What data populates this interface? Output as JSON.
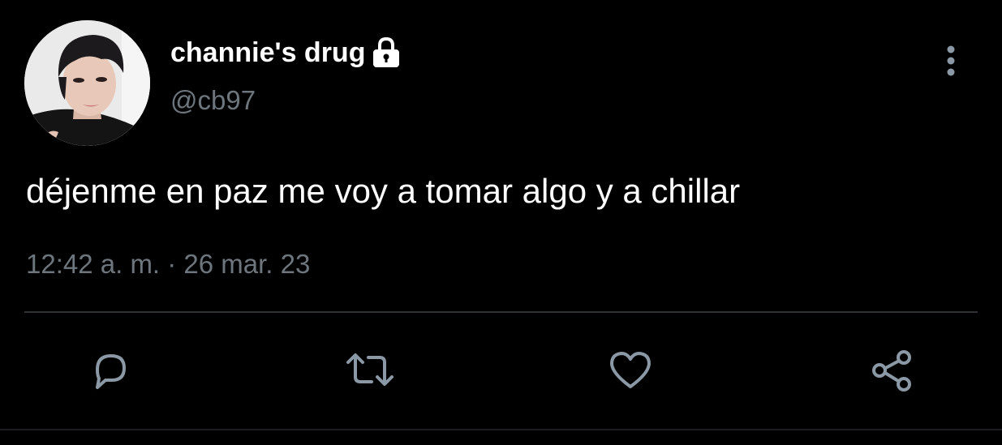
{
  "tweet": {
    "display_name": "channie's drug",
    "handle": "@cb97",
    "protected": true,
    "text": "déjenme en paz me voy a tomar algo y a chillar",
    "timestamp": "12:42 a. m. · 26 mar. 23"
  },
  "icons": {
    "protected": "lock-icon",
    "more": "more-vertical-icon",
    "reply": "reply-icon",
    "retweet": "retweet-icon",
    "like": "heart-icon",
    "share": "share-icon"
  },
  "colors": {
    "background": "#000000",
    "primary_text": "#ffffff",
    "secondary_text": "#6e767d",
    "icon": "#8b98a5",
    "divider": "#2f3336"
  }
}
